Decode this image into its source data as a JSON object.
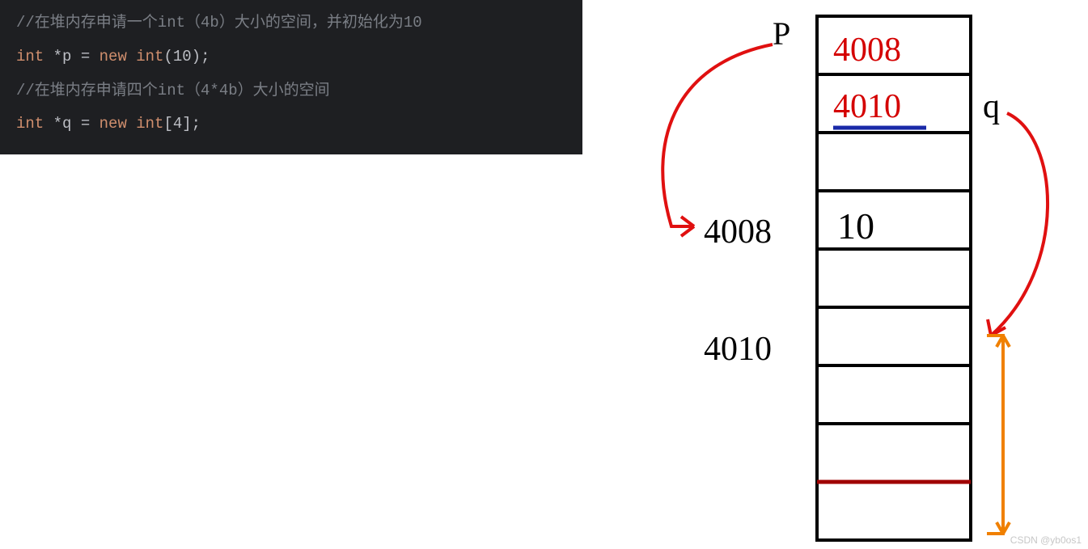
{
  "code": {
    "comment1": "//在堆内存申请一个int（4b）大小的空间，并初始化为10",
    "line1_kw1": "int",
    "line1_rest": " *p = ",
    "line1_kw2": "new int",
    "line1_tail": "(10);",
    "blank": "",
    "comment2": "//在堆内存申请四个int（4*4b）大小的空间",
    "line2_kw1": "int",
    "line2_rest": " *q = ",
    "line2_kw2": "new int",
    "line2_tail": "[4];"
  },
  "diagram": {
    "label_p": "P",
    "label_q": "q",
    "cell_p_value": "4008",
    "cell_q_value": "4010",
    "addr_4008": "4008",
    "cell_10": "10",
    "addr_4010": "4010",
    "cells_total": 9
  },
  "watermark": "CSDN @yb0os1"
}
